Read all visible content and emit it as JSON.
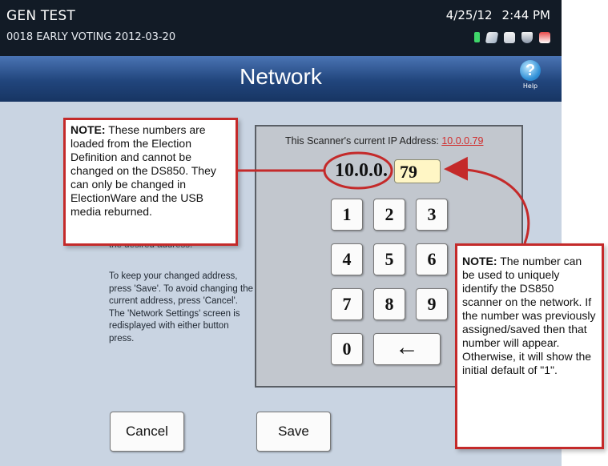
{
  "topbar": {
    "title": "GEN TEST",
    "subtitle": "0018 EARLY VOTING   2012-03-20",
    "date": "4/25/12",
    "time": "2:44 PM"
  },
  "header": {
    "title": "Network",
    "help_label": "Help"
  },
  "panel": {
    "ip_label": "This Scanner's current IP Address:",
    "ip_value": "10.0.0.79",
    "ip_prefix": "10.0.0.",
    "ip_last_octet": "79",
    "keys": [
      "1",
      "2",
      "3",
      "4",
      "5",
      "6",
      "7",
      "8",
      "9",
      "0"
    ],
    "backspace": "←"
  },
  "instructions": {
    "ghost_text": "the desired address.",
    "text": "To keep your changed address, press 'Save'. To avoid changing the current address, press 'Cancel'. The 'Network Settings' screen is redisplayed with either button press."
  },
  "buttons": {
    "cancel": "Cancel",
    "save": "Save"
  },
  "notes": {
    "note1_label": "NOTE:",
    "note1_text": " These numbers are loaded from the Election Definition and cannot be changed on the DS850.  They can only be changed in ElectionWare and the USB media reburned.",
    "note2_label": "NOTE:",
    "note2_text": " The number can be used to uniquely identify the DS850 scanner on the network. If the number was previously assigned/saved then that number will appear. Otherwise, it will show the initial default of \"1\"."
  },
  "status_icons": [
    "battery-icon",
    "plug-icon",
    "document-icon",
    "shield-icon",
    "lock-icon"
  ],
  "colors": {
    "annotation_red": "#c42a2a",
    "header_blue": "#21457c",
    "ip_link_red": "#d12c2c"
  }
}
